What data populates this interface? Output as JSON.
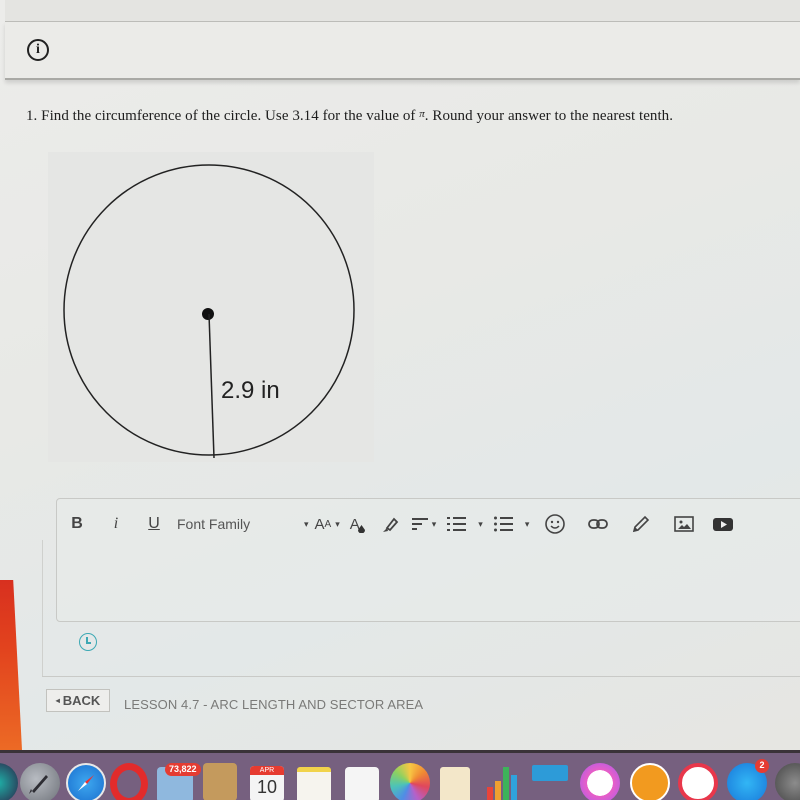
{
  "header": {
    "info_icon": "info-icon"
  },
  "question": {
    "number": "1.",
    "text_before_pi": "Find the circumference of the circle.  Use 3.14 for the value of",
    "pi_symbol": "π",
    "text_after_pi": ".  Round your answer to the nearest tenth."
  },
  "figure": {
    "radius_label": "2.9 in",
    "shape": "circle",
    "radius_value": 2.9,
    "radius_unit": "in"
  },
  "editor": {
    "toolbar": {
      "bold": "B",
      "italic": "i",
      "underline": "U",
      "font_family": "Font Family",
      "font_size_big": "A",
      "font_size_small": "A",
      "caret": "▾",
      "text_color": "A",
      "icons": [
        "highlighter-icon",
        "align-icon",
        "numbered-list-icon",
        "bullet-list-icon",
        "emoji-icon",
        "link-icon",
        "pencil-icon",
        "image-icon",
        "video-icon"
      ]
    },
    "answer_value": ""
  },
  "footer": {
    "back_label": "BACK",
    "back_arrow": "◂",
    "lesson_title": "LESSON 4.7 - ARC LENGTH AND SECTOR AREA"
  },
  "dock": {
    "photos_badge": "73,822",
    "calendar_month": "APR",
    "calendar_day": "10",
    "app_store_badge": "2",
    "apps": [
      "siri",
      "launchpad",
      "safari",
      "opera",
      "preview",
      "contacts",
      "calendar",
      "notes",
      "reminders",
      "photos",
      "pages",
      "numbers",
      "keynote",
      "itunes",
      "ibooks",
      "news",
      "app-store",
      "system-preferences"
    ]
  },
  "colors": {
    "dock_bg": "#76607f",
    "accent_teal": "#3ca8b4",
    "badge_red": "#e53c32"
  }
}
